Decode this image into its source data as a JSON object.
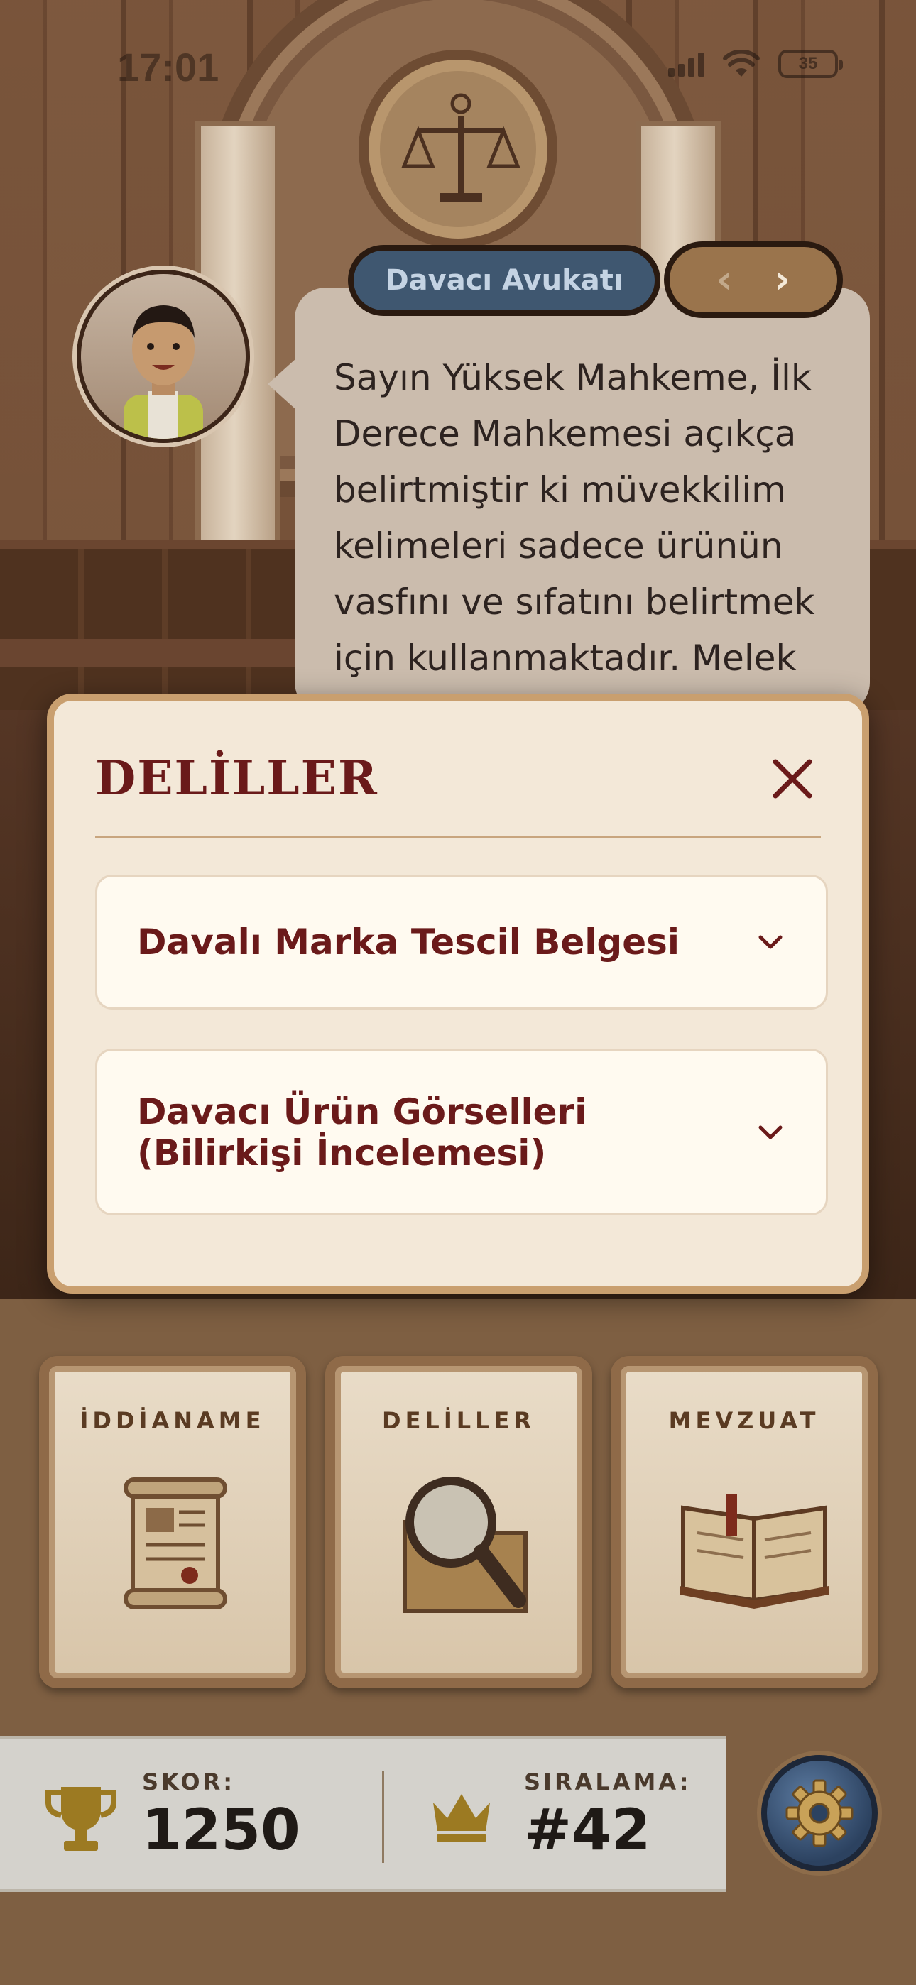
{
  "status_bar": {
    "time": "17:01",
    "battery": "35",
    "icons": [
      "cellular-signal-icon",
      "wifi-icon",
      "battery-icon"
    ]
  },
  "dialogue": {
    "speaker": "Davacı Avukatı",
    "text": "Sayın Yüksek Mahkeme, İlk Derece Mahkemesi açıkça belirtmiştir ki müvekkilim kelimeleri sadece ürünün vasfını ve sıfatını belirtmek için kullanmaktadır. Melek",
    "prev_icon": "chevron-left-icon",
    "next_icon": "chevron-right-icon"
  },
  "evidence_modal": {
    "title": "DELİLLER",
    "items": [
      {
        "label": "Davalı Marka Tescil Belgesi"
      },
      {
        "label": "Davacı Ürün Görselleri (Bilirkişi İncelemesi)"
      }
    ]
  },
  "menu_cards": [
    {
      "label": "İDDİANAME",
      "icon": "scroll-icon"
    },
    {
      "label": "DELİLLER",
      "icon": "magnifier-folder-icon"
    },
    {
      "label": "MEVZUAT",
      "icon": "open-book-icon"
    }
  ],
  "stats": {
    "score_label": "SKOR:",
    "score_value": "1250",
    "rank_label": "SIRALAMA:",
    "rank_value": "#42"
  },
  "colors": {
    "modal_title": "#6a1a1a",
    "modal_border": "#c99f6f",
    "speaker_tab": "#3f5770",
    "trophy": "#9c7a22",
    "settings_button": "#2c4260"
  }
}
